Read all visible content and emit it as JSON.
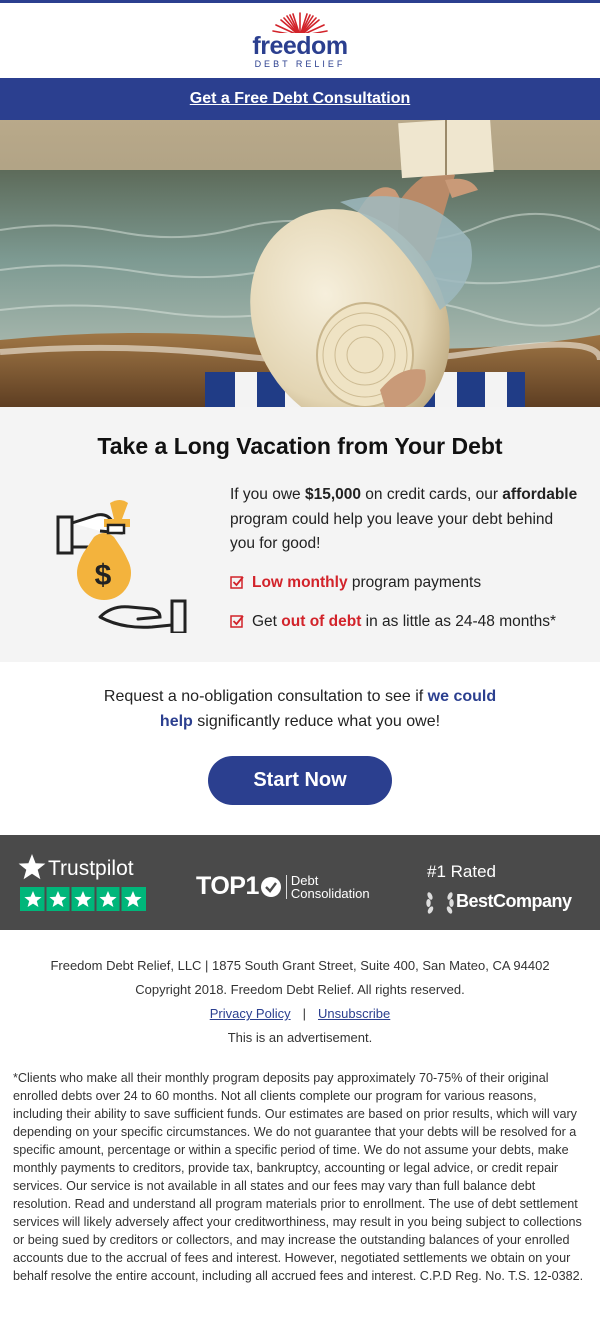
{
  "brand": {
    "name": "freedom",
    "tagline": "DEBT RELIEF"
  },
  "cta_bar": {
    "label": "Get a Free Debt Consultation"
  },
  "headline": {
    "bold": "Take a Long Vacation",
    "rest": " from Your Debt"
  },
  "intro": {
    "p1": "If you owe ",
    "amount": "$15,000",
    "p2": " on credit cards, our ",
    "affordable": "affordable",
    "p3": " program could help you leave your debt behind you for good!"
  },
  "checks": [
    {
      "red": "Low monthly",
      "rest": " program payments",
      "pre": ""
    },
    {
      "pre": "Get ",
      "red": "out of debt",
      "rest": " in as little as 24-48 months*"
    }
  ],
  "request": {
    "p1": "Request a no-obligation consultation to see if ",
    "highlight": "we could help",
    "p2": " significantly reduce what you owe!"
  },
  "start_button": {
    "label": "Start Now"
  },
  "trust": {
    "trustpilot": "Trustpilot",
    "top10": "TOP1",
    "top10_sub1": "Debt",
    "top10_sub2": "Consolidation",
    "rated": "#1 Rated",
    "best_company": "BestCompany"
  },
  "footer": {
    "address": "Freedom Debt Relief, LLC | 1875 South Grant Street, Suite 400, San Mateo, CA 94402",
    "copyright": "Copyright 2018. Freedom Debt Relief. All rights reserved.",
    "privacy": "Privacy Policy",
    "separator": "|",
    "unsubscribe": "Unsubscribe",
    "advertisement": "This is an advertisement."
  },
  "disclaimer": "*Clients who make all their monthly program deposits pay approximately 70-75% of their original enrolled debts over 24 to 60 months. Not all clients complete our program for various reasons, including their ability to save sufficient funds. Our estimates are based on prior results, which will vary depending on your specific circumstances. We do not guarantee that your debts will be resolved for a specific amount, percentage or within a specific period of time. We do not assume your debts, make monthly payments to creditors, provide tax, bankruptcy, accounting or legal advice, or credit repair services. Our service is not available in all states and our fees may vary than full balance debt resolution. Read and understand all program materials prior to enrollment. The use of debt settlement services will likely adversely affect your creditworthiness, may result in you being subject to collections or being sued by creditors or collectors, and may increase the outstanding balances of your enrolled accounts due to the accrual of fees and interest. However, negotiated settlements we obtain on your behalf resolve the entire account, including all accrued fees and interest. C.P.D Reg. No. T.S. 12-0382.",
  "colors": {
    "brand_blue": "#2b3f8f",
    "accent_red": "#d2232a",
    "coin_gold": "#f3b33d",
    "trust_band": "#4a4a4a",
    "trustpilot_green": "#00b67a"
  }
}
